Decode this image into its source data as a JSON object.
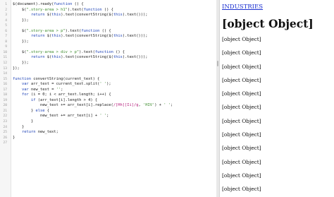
{
  "editor": {
    "lines": [
      {
        "n": "1",
        "segs": [
          {
            "t": "$(document).ready(",
            "c": ""
          },
          {
            "t": "function",
            "c": "kw"
          },
          {
            "t": " () {",
            "c": ""
          }
        ]
      },
      {
        "n": "2",
        "segs": [
          {
            "t": "    $(",
            "c": ""
          },
          {
            "t": "\".story-area > h1\"",
            "c": "str"
          },
          {
            "t": ").text(",
            "c": ""
          },
          {
            "t": "function",
            "c": "kw"
          },
          {
            "t": " () {",
            "c": ""
          }
        ]
      },
      {
        "n": "3",
        "segs": [
          {
            "t": "        ",
            "c": ""
          },
          {
            "t": "return",
            "c": "kw"
          },
          {
            "t": " $(",
            "c": ""
          },
          {
            "t": "this",
            "c": "kw"
          },
          {
            "t": ").text(convertString($(",
            "c": ""
          },
          {
            "t": "this",
            "c": "kw"
          },
          {
            "t": ").text()));",
            "c": ""
          }
        ]
      },
      {
        "n": "4",
        "segs": [
          {
            "t": "    });",
            "c": ""
          }
        ]
      },
      {
        "n": "5",
        "segs": [
          {
            "t": "",
            "c": ""
          }
        ]
      },
      {
        "n": "6",
        "segs": [
          {
            "t": "    $(",
            "c": ""
          },
          {
            "t": "\".story-area > p\"",
            "c": "str"
          },
          {
            "t": ").text(",
            "c": ""
          },
          {
            "t": "function",
            "c": "kw"
          },
          {
            "t": " () {",
            "c": ""
          }
        ]
      },
      {
        "n": "7",
        "segs": [
          {
            "t": "        ",
            "c": ""
          },
          {
            "t": "return",
            "c": "kw"
          },
          {
            "t": " $(",
            "c": ""
          },
          {
            "t": "this",
            "c": "kw"
          },
          {
            "t": ").text(convertString($(",
            "c": ""
          },
          {
            "t": "this",
            "c": "kw"
          },
          {
            "t": ").text()));",
            "c": ""
          }
        ]
      },
      {
        "n": "8",
        "segs": [
          {
            "t": "    });",
            "c": ""
          }
        ]
      },
      {
        "n": "9",
        "segs": [
          {
            "t": "",
            "c": ""
          }
        ]
      },
      {
        "n": "10",
        "segs": [
          {
            "t": "    $(",
            "c": ""
          },
          {
            "t": "\".story-area > div > p\"",
            "c": "str"
          },
          {
            "t": ").text(",
            "c": ""
          },
          {
            "t": "function",
            "c": "kw"
          },
          {
            "t": " () {",
            "c": ""
          }
        ]
      },
      {
        "n": "11",
        "segs": [
          {
            "t": "        ",
            "c": ""
          },
          {
            "t": "return",
            "c": "kw"
          },
          {
            "t": " $(",
            "c": ""
          },
          {
            "t": "this",
            "c": "kw"
          },
          {
            "t": ").text(convertString($(",
            "c": ""
          },
          {
            "t": "this",
            "c": "kw"
          },
          {
            "t": ").text()));",
            "c": ""
          }
        ]
      },
      {
        "n": "12",
        "segs": [
          {
            "t": "    });",
            "c": ""
          }
        ]
      },
      {
        "n": "13",
        "segs": [
          {
            "t": "});",
            "c": ""
          }
        ]
      },
      {
        "n": "14",
        "segs": [
          {
            "t": "",
            "c": ""
          }
        ]
      },
      {
        "n": "15",
        "segs": [
          {
            "t": "function",
            "c": "kw"
          },
          {
            "t": " convertString(current_text) {",
            "c": ""
          }
        ]
      },
      {
        "n": "16",
        "segs": [
          {
            "t": "    ",
            "c": ""
          },
          {
            "t": "var",
            "c": "kw"
          },
          {
            "t": " arr_text = current_text.split(",
            "c": ""
          },
          {
            "t": "' '",
            "c": "str"
          },
          {
            "t": ");",
            "c": ""
          }
        ]
      },
      {
        "n": "17",
        "segs": [
          {
            "t": "    ",
            "c": ""
          },
          {
            "t": "var",
            "c": "kw"
          },
          {
            "t": " new_text = ",
            "c": ""
          },
          {
            "t": "''",
            "c": "str"
          },
          {
            "t": ";",
            "c": ""
          }
        ]
      },
      {
        "n": "18",
        "segs": [
          {
            "t": "    ",
            "c": ""
          },
          {
            "t": "for",
            "c": "kw"
          },
          {
            "t": " (i = 0; i < arr_text.length; i++) {",
            "c": ""
          }
        ]
      },
      {
        "n": "19",
        "segs": [
          {
            "t": "        ",
            "c": ""
          },
          {
            "t": "if",
            "c": "kw"
          },
          {
            "t": " (arr_text[i].length > 4) {",
            "c": ""
          }
        ]
      },
      {
        "n": "20",
        "segs": [
          {
            "t": "            new_text += arr_text[i].replace(",
            "c": ""
          },
          {
            "t": "/[Hh][Ii]/g",
            "c": "re"
          },
          {
            "t": ", ",
            "c": ""
          },
          {
            "t": "'HIV'",
            "c": "str"
          },
          {
            "t": ") + ",
            "c": ""
          },
          {
            "t": "' '",
            "c": "str"
          },
          {
            "t": ";",
            "c": ""
          }
        ]
      },
      {
        "n": "21",
        "segs": [
          {
            "t": "        } ",
            "c": ""
          },
          {
            "t": "else",
            "c": "kw"
          },
          {
            "t": " {",
            "c": ""
          }
        ]
      },
      {
        "n": "22",
        "segs": [
          {
            "t": "            new_text += arr_text[i] + ",
            "c": ""
          },
          {
            "t": "' '",
            "c": "str"
          },
          {
            "t": ";",
            "c": ""
          }
        ]
      },
      {
        "n": "23",
        "segs": [
          {
            "t": "        }",
            "c": ""
          }
        ]
      },
      {
        "n": "24",
        "segs": [
          {
            "t": "    }",
            "c": ""
          }
        ]
      },
      {
        "n": "25",
        "segs": [
          {
            "t": "    ",
            "c": ""
          },
          {
            "t": "return",
            "c": "kw"
          },
          {
            "t": " new_text;",
            "c": ""
          }
        ]
      },
      {
        "n": "26",
        "segs": [
          {
            "t": "}",
            "c": ""
          }
        ]
      },
      {
        "n": "27",
        "segs": [
          {
            "t": "",
            "c": ""
          }
        ]
      }
    ]
  },
  "preview": {
    "link_text": "INDUSTRIES",
    "heading": "[object Object]",
    "paragraphs": [
      "[object Object]",
      "[object Object]",
      "[object Object]",
      "[object Object]",
      "[object Object]",
      "[object Object]",
      "[object Object]",
      "[object Object]",
      "[object Object]",
      "[object Object]",
      "[object Object]",
      "[object Object]"
    ]
  },
  "colors": {
    "keyword": "#1a3fb5",
    "string": "#3a8a2a",
    "regex": "#b51a7a",
    "link": "#1a2fd0"
  }
}
